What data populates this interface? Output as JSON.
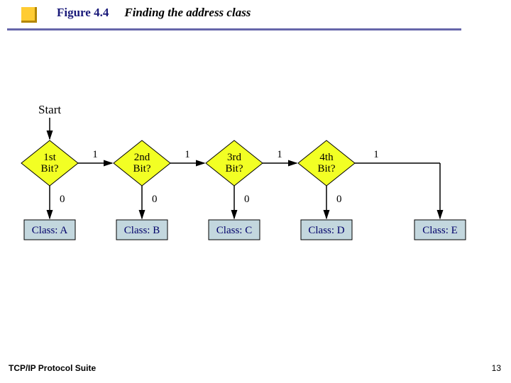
{
  "header": {
    "figure_number": "Figure 4.4",
    "figure_title": "Finding the address class"
  },
  "footer": {
    "left": "TCP/IP Protocol Suite",
    "page": "13"
  },
  "diagram": {
    "start": "Start",
    "decisions": [
      {
        "label_top": "1st",
        "label_bot": "Bit?"
      },
      {
        "label_top": "2nd",
        "label_bot": "Bit?"
      },
      {
        "label_top": "3rd",
        "label_bot": "Bit?"
      },
      {
        "label_top": "4th",
        "label_bot": "Bit?"
      }
    ],
    "classes": [
      "Class: A",
      "Class: B",
      "Class: C",
      "Class: D",
      "Class: E"
    ],
    "edges": {
      "yes": "1",
      "no": "0"
    },
    "colors": {
      "decision_fill": "#f2ff24",
      "class_fill": "#c3d7de",
      "arrow": "#000"
    }
  }
}
